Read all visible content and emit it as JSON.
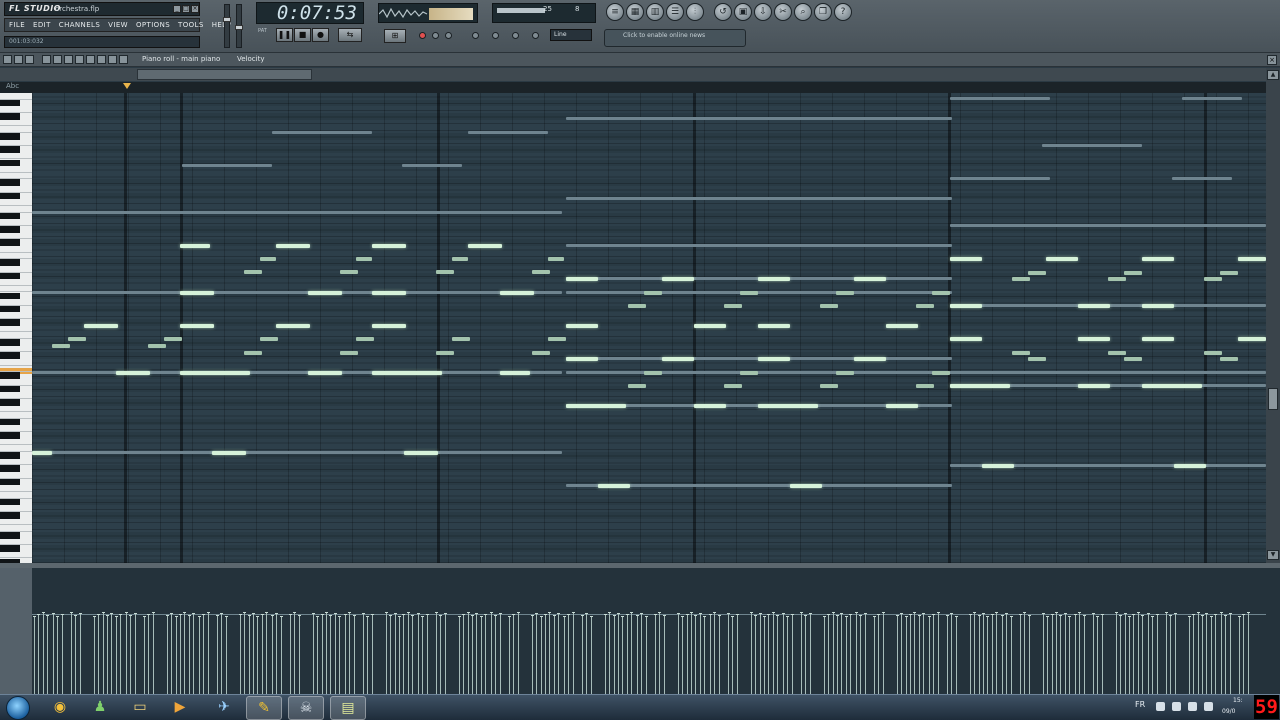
{
  "app": {
    "logo": "FL STUDIO",
    "file_name": "orchestra.flp",
    "hint_text": "001:03:032",
    "menu": [
      "FILE",
      "EDIT",
      "CHANNELS",
      "VIEW",
      "OPTIONS",
      "TOOLS",
      "HELP"
    ]
  },
  "transport": {
    "time": "0:07:53",
    "cpu_value": "25",
    "poly_value": "8",
    "snap": "Line",
    "news": "Click to enable online news"
  },
  "piano_roll": {
    "title": "Piano roll - main piano",
    "target": "Velocity",
    "keyboard_label": "Abc"
  },
  "taskbar": {
    "apps": [
      "chrome",
      "messenger",
      "explorer",
      "media-player",
      "flight",
      "fl-studio",
      "game",
      "flstudio-window"
    ],
    "lang": "FR",
    "clock_line1": "15:",
    "clock_line2": "09/0",
    "fps": "59"
  },
  "colors": {
    "grid_bg": "#2d3f4a",
    "note_highlight": "#d6f2d9",
    "note_sustain": "#6f848f",
    "playhead": "#e9b44b",
    "fps_red": "#ff1a1a"
  }
}
